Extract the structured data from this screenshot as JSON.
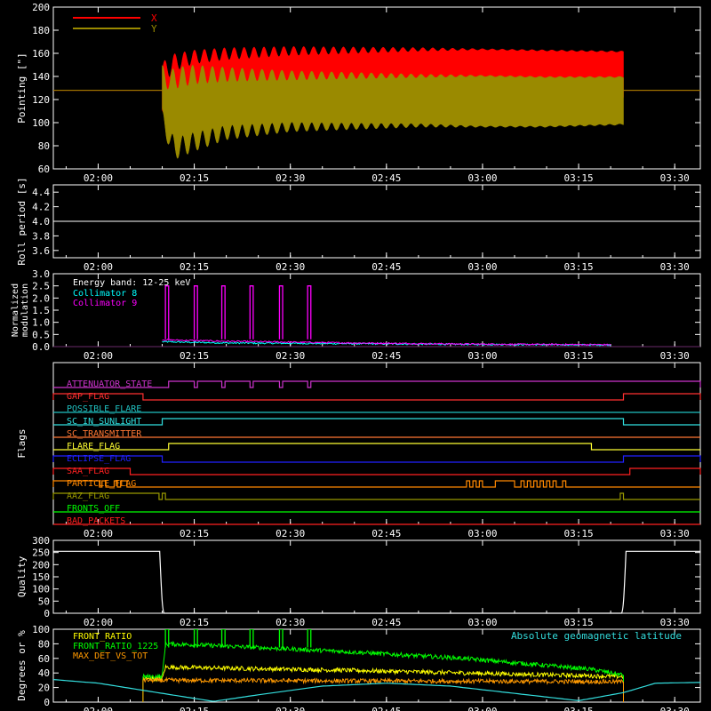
{
  "chart_data": [
    {
      "type": "line",
      "ylabel": "Pointing [\"]",
      "ylim": [
        60,
        200
      ],
      "yticks": [
        "60",
        "80",
        "100",
        "120",
        "140",
        "160",
        "180",
        "200"
      ],
      "xlabel": "",
      "xticks": [
        "02:00",
        "02:15",
        "02:30",
        "02:45",
        "03:00",
        "03:15",
        "03:30"
      ],
      "legend_position": "top-left",
      "series": [
        {
          "name": "X",
          "color": "#ff0000",
          "start": "02:10",
          "end": "03:22",
          "outside_value": 128,
          "upper_envelope": [
            [
              0,
              152
            ],
            [
              0.6,
              155
            ],
            [
              2,
              160
            ],
            [
              5,
              163
            ],
            [
              10,
              165
            ],
            [
              20,
              166
            ],
            [
              40,
              165
            ],
            [
              60,
              163
            ],
            [
              72,
              162
            ]
          ],
          "lower_envelope": [
            [
              0,
              105
            ],
            [
              0.6,
              78
            ],
            [
              2,
              95
            ],
            [
              5,
              108
            ],
            [
              10,
              112
            ],
            [
              20,
              115
            ],
            [
              40,
              118
            ],
            [
              60,
              120
            ],
            [
              72,
              121
            ]
          ]
        },
        {
          "name": "Y",
          "color": "#9a8a00",
          "start": "02:10",
          "end": "03:22",
          "outside_value": 128,
          "upper_envelope": [
            [
              0,
              150
            ],
            [
              0.6,
              143
            ],
            [
              2,
              148
            ],
            [
              5,
              150
            ],
            [
              10,
              148
            ],
            [
              20,
              145
            ],
            [
              40,
              142
            ],
            [
              60,
              140
            ],
            [
              72,
              140
            ]
          ],
          "lower_envelope": [
            [
              0,
              100
            ],
            [
              0.6,
              85
            ],
            [
              2,
              68
            ],
            [
              5,
              75
            ],
            [
              10,
              85
            ],
            [
              20,
              92
            ],
            [
              40,
              96
            ],
            [
              60,
              96
            ],
            [
              72,
              98
            ]
          ]
        }
      ]
    },
    {
      "type": "line",
      "ylabel": "Roll period [s]",
      "ylim": [
        3.5,
        4.5
      ],
      "yticks": [
        "3.6",
        "3.8",
        "4.0",
        "4.2",
        "4.4"
      ],
      "xticks": [
        "02:00",
        "02:15",
        "02:30",
        "02:45",
        "03:00",
        "03:15",
        "03:30"
      ],
      "series": [
        {
          "name": "",
          "color": "#ffffff",
          "value": 4.0
        }
      ]
    },
    {
      "type": "line",
      "ylabel": "Normalized modulation",
      "ylim": [
        0,
        3
      ],
      "yticks": [
        "0.0",
        "0.5",
        "1.0",
        "1.5",
        "2.0",
        "2.5",
        "3.0"
      ],
      "xticks": [
        "02:00",
        "02:15",
        "02:30",
        "02:45",
        "03:00",
        "03:15",
        "03:30"
      ],
      "legend_title": "Energy band: 12-25 keV",
      "series": [
        {
          "name": "Collimator 8",
          "color": "#00ffff",
          "start": "02:10",
          "end": "03:20",
          "level": [
            [
              0,
              0.2
            ],
            [
              10,
              0.15
            ],
            [
              30,
              0.12
            ],
            [
              50,
              0.09
            ],
            [
              70,
              0.07
            ]
          ]
        },
        {
          "name": "Collimator 9",
          "color": "#ff00ff",
          "start": "02:10",
          "end": "03:20",
          "level": [
            [
              0,
              0.28
            ],
            [
              10,
              0.22
            ],
            [
              30,
              0.15
            ],
            [
              50,
              0.1
            ],
            [
              70,
              0.08
            ]
          ],
          "spikes": [
            [
              "02:10.5",
              "02:11"
            ],
            [
              "02:15",
              "02:15.5"
            ],
            [
              "02:19.3",
              "02:19.8"
            ],
            [
              "02:23.7",
              "02:24.2"
            ],
            [
              "02:28.3",
              "02:28.8"
            ],
            [
              "02:32.7",
              "02:33.2"
            ]
          ],
          "spike_value": 2.5
        }
      ]
    },
    {
      "type": "line",
      "ylabel": "Flags",
      "xticks": [
        "02:00",
        "02:15",
        "02:30",
        "02:45",
        "03:00",
        "03:15",
        "03:30"
      ],
      "flags": [
        {
          "name": "ATTENUATOR_STATE",
          "color": "#cc33cc",
          "on": [
            [
              "02:11",
              "02:15"
            ],
            [
              "02:15.5",
              "02:19.3"
            ],
            [
              "02:19.8",
              "02:23.7"
            ],
            [
              "02:24.2",
              "02:28.3"
            ],
            [
              "02:28.8",
              "02:32.7"
            ],
            [
              "02:33.2",
              "03:34"
            ]
          ]
        },
        {
          "name": "GAP_FLAG",
          "color": "#ff3030",
          "on": [
            [
              "01:53",
              "02:07"
            ],
            [
              "03:22",
              "03:34"
            ]
          ]
        },
        {
          "name": "POSSIBLE_FLARE",
          "color": "#20c0c0",
          "on": []
        },
        {
          "name": "SC_IN_SUNLIGHT",
          "color": "#30e0e0",
          "on": [
            [
              "02:10",
              "03:22"
            ]
          ]
        },
        {
          "name": "SC_TRANSMITTER",
          "color": "#ff7733",
          "on": []
        },
        {
          "name": "FLARE_FLAG",
          "color": "#ffff33",
          "on": [
            [
              "02:11",
              "03:17"
            ]
          ]
        },
        {
          "name": "ECLIPSE_FLAG",
          "color": "#2020ff",
          "on": [
            [
              "01:53",
              "02:10"
            ],
            [
              "03:22",
              "03:34"
            ]
          ]
        },
        {
          "name": "SAA_FLAG",
          "color": "#ff2020",
          "on": [
            [
              "01:53",
              "02:05"
            ],
            [
              "03:23",
              "03:34"
            ]
          ]
        },
        {
          "name": "PARTICLE_FLAG",
          "color": "#ff8800",
          "on": [
            [
              "01:53",
              "02:00.2"
            ],
            [
              "02:00.6",
              "02:01.2"
            ],
            [
              "02:02.5",
              "02:03"
            ],
            [
              "02:03.5",
              "02:04.5"
            ],
            [
              "02:57.5",
              "02:58"
            ],
            [
              "02:58.5",
              "02:59"
            ],
            [
              "02:59.5",
              "03:00"
            ],
            [
              "03:02",
              "03:05"
            ],
            [
              "03:06",
              "03:06.5"
            ],
            [
              "03:07",
              "03:07.5"
            ],
            [
              "03:08",
              "03:08.5"
            ],
            [
              "03:09",
              "03:09.5"
            ],
            [
              "03:10",
              "03:10.5"
            ],
            [
              "03:11",
              "03:11.5"
            ],
            [
              "03:12.5",
              "03:13"
            ]
          ]
        },
        {
          "name": "AAZ_FLAG",
          "color": "#999900",
          "on": [
            [
              "01:53",
              "02:09.5"
            ],
            [
              "02:10",
              "02:10.5"
            ],
            [
              "03:21.5",
              "03:22"
            ]
          ]
        },
        {
          "name": "FRONTS_OFF",
          "color": "#00ff00",
          "on": []
        },
        {
          "name": "BAD_PACKETS",
          "color": "#ff2020",
          "on": []
        }
      ]
    },
    {
      "type": "line",
      "ylabel": "Quality",
      "ylim": [
        0,
        300
      ],
      "yticks": [
        "0",
        "50",
        "100",
        "150",
        "200",
        "250",
        "300"
      ],
      "xticks": [
        "02:00",
        "02:15",
        "02:30",
        "02:45",
        "03:00",
        "03:15",
        "03:30"
      ],
      "series": [
        {
          "name": "",
          "color": "#ffffff",
          "value": 255,
          "low_start": "02:10",
          "low_end": "03:22",
          "low_value": 0
        }
      ]
    },
    {
      "type": "line",
      "ylabel": "Degrees or %",
      "ylim": [
        0,
        100
      ],
      "yticks": [
        "0",
        "20",
        "40",
        "60",
        "80",
        "100"
      ],
      "xticks": [
        "02:00",
        "02:15",
        "02:30",
        "02:45",
        "03:00",
        "03:15",
        "03:30"
      ],
      "legend_position": "top-left",
      "annotation": "Absolute geomagnetic latitude",
      "series": [
        {
          "name": "FRONT_RATIO",
          "color": "#ffff00",
          "start": "02:07",
          "end": "03:22",
          "level": [
            [
              0,
              32
            ],
            [
              3,
              32
            ],
            [
              3.5,
              48
            ],
            [
              10,
              47
            ],
            [
              30,
              44
            ],
            [
              50,
              40
            ],
            [
              70,
              36
            ],
            [
              75,
              35
            ]
          ]
        },
        {
          "name": "FRONT_RATIO_1225",
          "color": "#00ff00",
          "start": "02:07",
          "end": "03:22",
          "level": [
            [
              0,
              35
            ],
            [
              3,
              35
            ],
            [
              3.5,
              80
            ],
            [
              10,
              78
            ],
            [
              30,
              70
            ],
            [
              50,
              60
            ],
            [
              70,
              45
            ],
            [
              75,
              37
            ]
          ],
          "spikes": [
            [
              "02:10.5",
              "02:11"
            ],
            [
              "02:15",
              "02:15.5"
            ],
            [
              "02:19.3",
              "02:19.8"
            ],
            [
              "02:23.7",
              "02:24.2"
            ],
            [
              "02:28.3",
              "02:28.8"
            ],
            [
              "02:32.7",
              "02:33.2"
            ]
          ],
          "spike_value": 100
        },
        {
          "name": "MAX_DET_VS_TOT",
          "color": "#ff9900",
          "start": "02:07",
          "end": "03:22",
          "level": [
            [
              0,
              30
            ],
            [
              75,
              28
            ]
          ]
        },
        {
          "name": "Absolute geomagnetic latitude",
          "color": "#33dddd",
          "points": [
            [
              "01:53",
              31
            ],
            [
              "02:00",
              26
            ],
            [
              "02:10",
              12
            ],
            [
              "02:18",
              1
            ],
            [
              "02:25",
              10
            ],
            [
              "02:35",
              22
            ],
            [
              "02:45",
              26
            ],
            [
              "02:55",
              22
            ],
            [
              "03:05",
              12
            ],
            [
              "03:15",
              2
            ],
            [
              "03:22",
              13
            ],
            [
              "03:27",
              26
            ],
            [
              "03:34",
              27
            ]
          ]
        }
      ]
    }
  ]
}
